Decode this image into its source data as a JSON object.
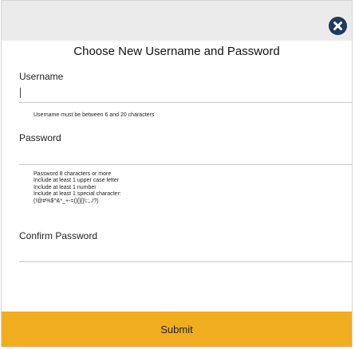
{
  "dialog": {
    "title": "Choose New Username and Password",
    "close_icon": "close-circle-icon",
    "accent_color": "#f0ad1f"
  },
  "username": {
    "label": "Username",
    "value": "",
    "hint": "Username must be between 6 and 20 characters"
  },
  "password": {
    "label": "Password",
    "value": "",
    "requirements": [
      "Password 8 characters or more",
      "Include at least 1 upper case letter",
      "Include at least 1 number",
      "Include at least 1 special character:",
      "(!@#%$^&*_+-=()[]{}\\:;,./?)"
    ]
  },
  "confirm_password": {
    "label": "Confirm Password",
    "value": ""
  },
  "submit": {
    "label": "Submit"
  }
}
